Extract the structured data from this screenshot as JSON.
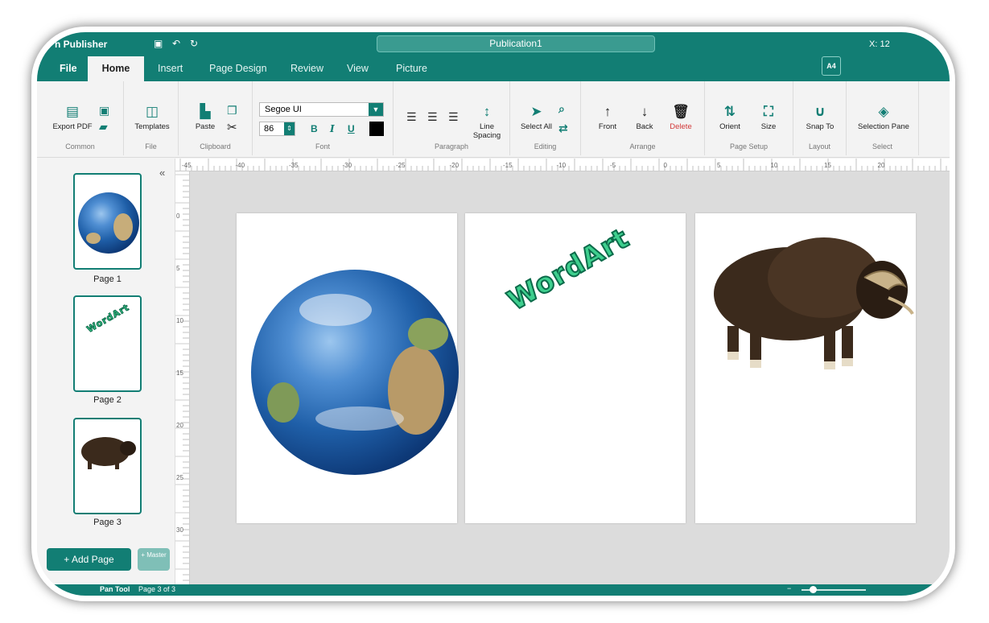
{
  "app": {
    "title": "n Publisher",
    "document_name": "Publication1",
    "coords": "X: 12"
  },
  "tabs": [
    "File",
    "Home",
    "Insert",
    "Page Design",
    "Review",
    "View",
    "Picture"
  ],
  "paper_size_badge": "A4",
  "ribbon": {
    "common": {
      "label": "Common",
      "export_pdf": "Export PDF"
    },
    "file": {
      "label": "File",
      "templates": "Templates"
    },
    "clipboard": {
      "label": "Clipboard",
      "paste": "Paste"
    },
    "font": {
      "label": "Font",
      "family": "Segoe UI",
      "size": "86",
      "bold": "B",
      "italic": "I",
      "underline": "U",
      "color": "#000000"
    },
    "paragraph": {
      "label": "Paragraph",
      "line_spacing": "Line Spacing"
    },
    "editing": {
      "label": "Editing",
      "select_all": "Select All"
    },
    "arrange": {
      "label": "Arrange",
      "front": "Front",
      "back": "Back",
      "delete": "Delete"
    },
    "page_setup": {
      "label": "Page Setup",
      "orient": "Orient",
      "size": "Size"
    },
    "layout": {
      "label": "Layout",
      "snap_to": "Snap To"
    },
    "select": {
      "label": "Select",
      "selection_pane": "Selection Pane"
    }
  },
  "pages_panel": {
    "pages": [
      "Page 1",
      "Page 2",
      "Page 3"
    ],
    "add_page": "+ Add Page",
    "master": "+ Master"
  },
  "ruler": {
    "horizontal": [
      "-45",
      "-40",
      "-35",
      "-30",
      "-25",
      "-20",
      "-15",
      "-10",
      "-5",
      "0",
      "5",
      "10",
      "15",
      "20"
    ],
    "vertical": [
      "0",
      "5",
      "10",
      "15",
      "20",
      "25",
      "30"
    ]
  },
  "canvas": {
    "wordart_text": "WordArt"
  },
  "status": {
    "tool": "Pan Tool",
    "page_info": "Page 3 of 3",
    "zoom_minus": "−"
  },
  "colors": {
    "accent": "#127e74",
    "delete": "#d23a3a"
  }
}
